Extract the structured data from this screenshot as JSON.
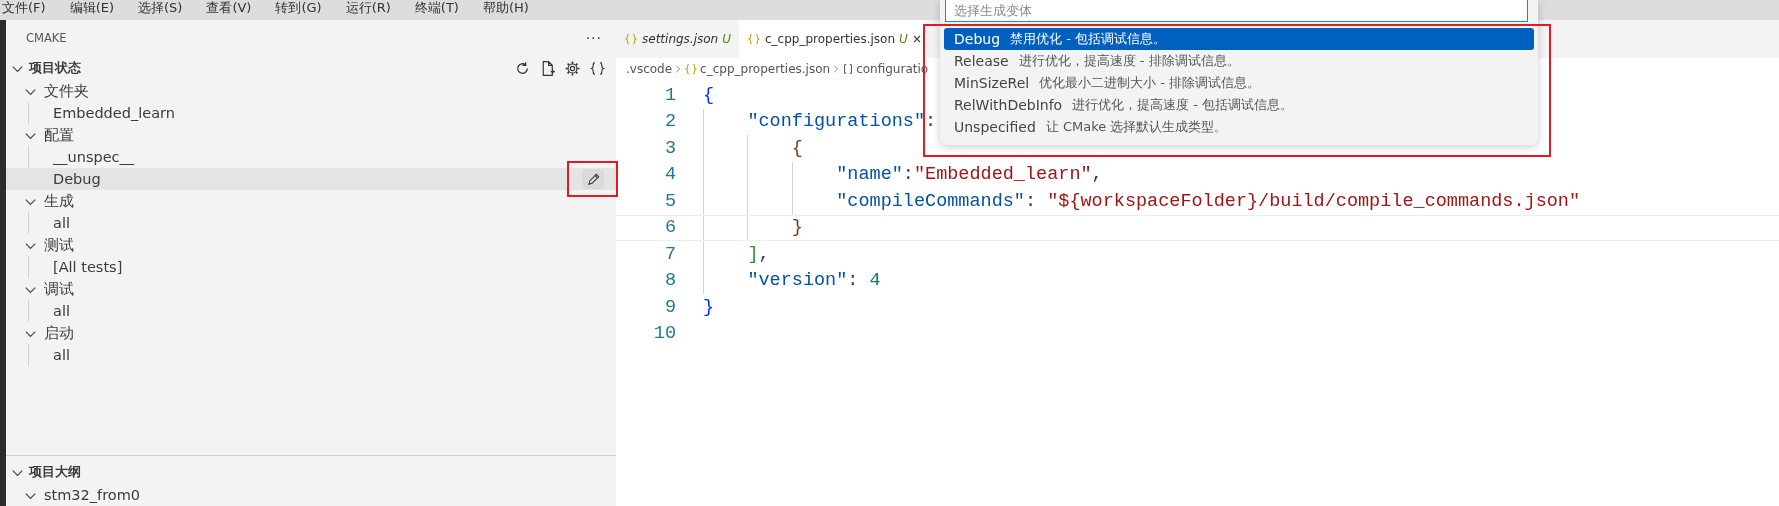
{
  "menu_bar": [
    "文件(F)",
    "编辑(E)",
    "选择(S)",
    "查看(V)",
    "转到(G)",
    "运行(R)",
    "终端(T)",
    "帮助(H)"
  ],
  "sidebar": {
    "title": "CMAKE",
    "more": "···",
    "project_status": {
      "title": "项目状态",
      "expanded": true,
      "items": [
        {
          "label": "文件夹",
          "expanded": true,
          "children": [
            {
              "label": "Embedded_learn",
              "selected": false
            }
          ]
        },
        {
          "label": "配置",
          "expanded": true,
          "children": [
            {
              "label": "__unspec__",
              "selected": false
            },
            {
              "label": "Debug",
              "selected": true,
              "edit_outlined": true
            }
          ]
        },
        {
          "label": "生成",
          "expanded": true,
          "children": [
            {
              "label": "all",
              "selected": false
            }
          ]
        },
        {
          "label": "测试",
          "expanded": true,
          "children": [
            {
              "label": "[All tests]",
              "selected": false
            }
          ]
        },
        {
          "label": "调试",
          "expanded": true,
          "children": [
            {
              "label": "all",
              "selected": false
            }
          ]
        },
        {
          "label": "启动",
          "expanded": true,
          "children": [
            {
              "label": "all",
              "selected": false
            }
          ]
        }
      ]
    },
    "project_outline": {
      "title": "项目大纲",
      "expanded": true,
      "items": [
        {
          "label": "stm32_from0",
          "expanded": true
        }
      ]
    }
  },
  "tabs": [
    {
      "label": "settings.json",
      "status": "U",
      "selected": false
    },
    {
      "label": "c_cpp_properties.json",
      "status": "U",
      "selected": true
    }
  ],
  "breadcrumb": [
    {
      "kind": "folder",
      "text": ".vscode"
    },
    {
      "kind": "json",
      "text": "c_cpp_properties.json"
    },
    {
      "kind": "array",
      "text": "configuratio"
    }
  ],
  "code_lines": [
    {
      "number": "1",
      "current": false,
      "tokens": [
        {
          "kind": "brace1",
          "text": "{"
        }
      ]
    },
    {
      "number": "2",
      "current": false,
      "tokens": [
        {
          "kind": "key",
          "text": "    \"configurations\""
        },
        {
          "kind": "punct",
          "text": ":"
        }
      ]
    },
    {
      "number": "3",
      "current": false,
      "tokens": [
        {
          "kind": "brace3",
          "text": "        {"
        }
      ]
    },
    {
      "number": "4",
      "current": false,
      "tokens": [
        {
          "kind": "key",
          "text": "            \"name\""
        },
        {
          "kind": "punct",
          "text": ":"
        },
        {
          "kind": "string",
          "text": "\"Embedded_learn\""
        },
        {
          "kind": "punct",
          "text": ","
        }
      ]
    },
    {
      "number": "5",
      "current": false,
      "tokens": [
        {
          "kind": "key",
          "text": "            \"compileCommands\""
        },
        {
          "kind": "punct",
          "text": ": "
        },
        {
          "kind": "string",
          "text": "\"${workspaceFolder}/build/compile_commands.json\""
        }
      ]
    },
    {
      "number": "6",
      "current": true,
      "tokens": [
        {
          "kind": "brace3",
          "text": "        }"
        }
      ]
    },
    {
      "number": "7",
      "current": false,
      "tokens": [
        {
          "kind": "brace2",
          "text": "    ]"
        },
        {
          "kind": "punct",
          "text": ","
        }
      ]
    },
    {
      "number": "8",
      "current": false,
      "tokens": [
        {
          "kind": "key",
          "text": "    \"version\""
        },
        {
          "kind": "punct",
          "text": ": "
        },
        {
          "kind": "number",
          "text": "4"
        }
      ]
    },
    {
      "number": "9",
      "current": false,
      "tokens": [
        {
          "kind": "brace1",
          "text": "}"
        }
      ]
    },
    {
      "number": "10",
      "current": false
    }
  ],
  "quick_pick": {
    "placeholder": "选择生成变体",
    "outlined": true,
    "items": [
      {
        "label": "Debug",
        "description": "禁用优化 - 包括调试信息。",
        "selected": true
      },
      {
        "label": "Release",
        "description": "进行优化，提高速度 - 排除调试信息。",
        "selected": false
      },
      {
        "label": "MinSizeRel",
        "description": "优化最小二进制大小 - 排除调试信息。",
        "selected": false
      },
      {
        "label": "RelWithDebInfo",
        "description": "进行优化，提高速度 - 包括调试信息。",
        "selected": false
      },
      {
        "label": "Unspecified",
        "description": "让 CMake 选择默认生成类型。",
        "selected": false
      }
    ]
  }
}
